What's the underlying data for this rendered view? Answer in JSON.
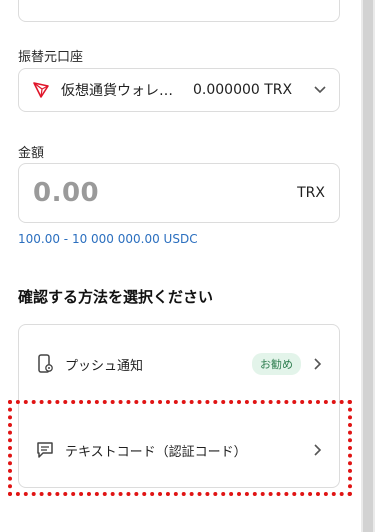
{
  "source_account": {
    "label": "振替元口座",
    "name": "仮想通貨ウォレット",
    "balance": "0.000000 TRX",
    "icon": "tron-icon"
  },
  "amount": {
    "label": "金額",
    "value": "0.00",
    "unit": "TRX",
    "range_hint": "100.00 - 10 000 000.00 USDC"
  },
  "verification": {
    "title": "確認する方法を選択ください",
    "methods": [
      {
        "label": "プッシュ通知",
        "badge": "お勧め",
        "icon": "phone-gear-icon"
      },
      {
        "label": "テキストコード（認証コード）",
        "icon": "message-icon"
      }
    ]
  },
  "colors": {
    "accent_blue": "#2b6fbf",
    "badge_green": "#2e7d4f",
    "badge_bg": "#e3f4ea",
    "highlight_red": "#e01414",
    "tron_red": "#e0162b"
  }
}
